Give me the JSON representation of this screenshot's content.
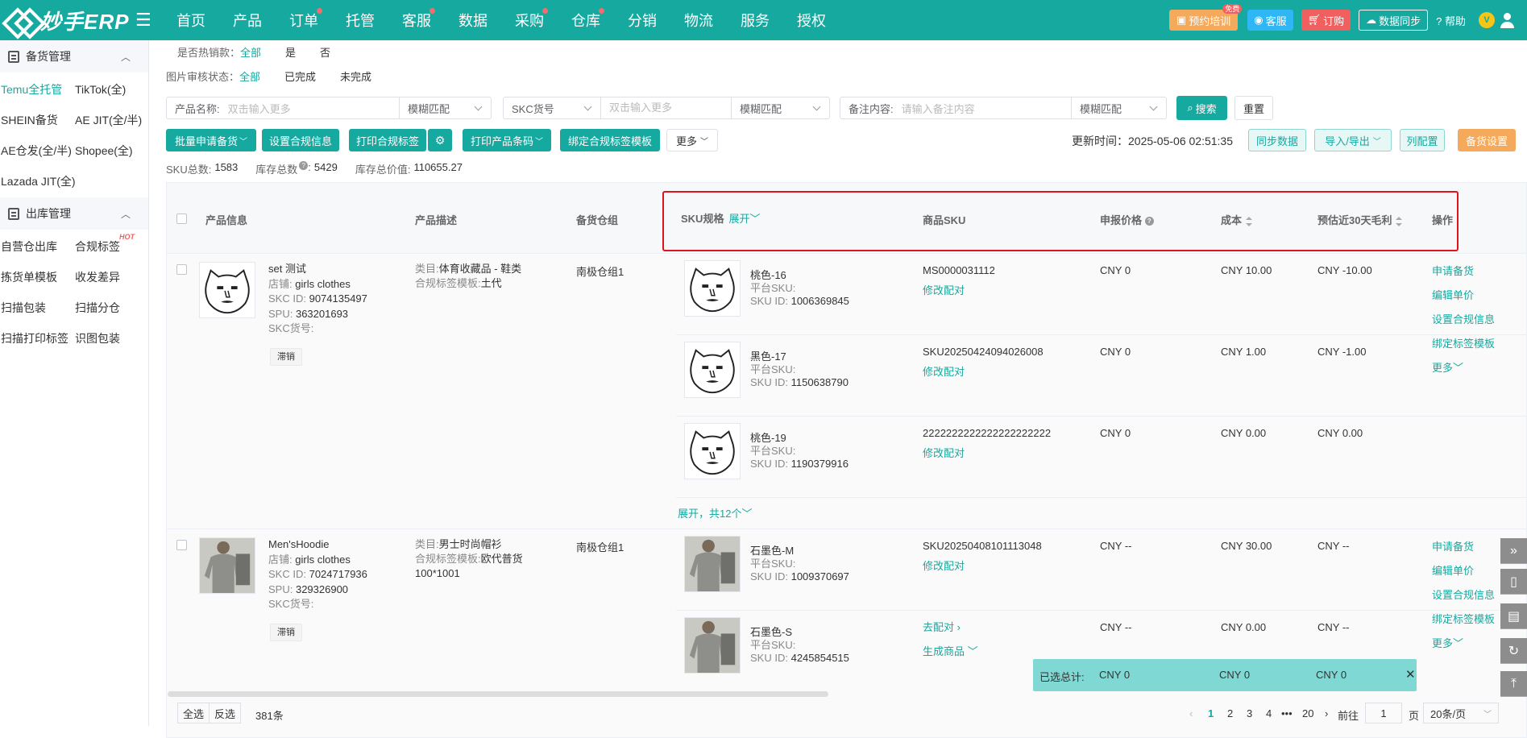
{
  "app": {
    "logo_text": "妙手ERP"
  },
  "nav": [
    "首页",
    "产品",
    "订单",
    "托管",
    "客服",
    "数据",
    "采购",
    "仓库",
    "分销",
    "物流",
    "服务",
    "授权"
  ],
  "nav_dots": [
    false,
    false,
    true,
    false,
    true,
    false,
    true,
    true,
    false,
    false,
    false,
    false
  ],
  "top_actions": {
    "training": "预约培训",
    "free": "免费",
    "service": "客服",
    "order": "订购",
    "sync": "数据同步",
    "help": "帮助",
    "avatar": "V"
  },
  "sidebar": {
    "section1": "备货管理",
    "section1_items": [
      "Temu全托管",
      "TikTok(全)",
      "SHEIN备货",
      "AE JIT(全/半)",
      "AE仓发(全/半)",
      "Shopee(全)",
      "Lazada JIT(全)"
    ],
    "section2": "出库管理",
    "section2_items": [
      "自营仓出库",
      "合规标签",
      "拣货单模板",
      "收发差异",
      "扫描包装",
      "扫描分仓",
      "扫描打印标签",
      "识图包装"
    ],
    "hot": "HOT"
  },
  "filters": {
    "hot_label": "是否热销款：",
    "hot_opts": [
      "全部",
      "是",
      "否"
    ],
    "img_label": "图片审核状态：",
    "img_opts": [
      "全部",
      "已完成",
      "未完成"
    ],
    "name_label": "产品名称:",
    "name_ph": "双击输入更多",
    "match1": "模糊匹配",
    "skc_label": "SKC货号",
    "skc_ph": "双击输入更多",
    "match2": "模糊匹配",
    "remark_label": "备注内容:",
    "remark_ph": "请输入备注内容",
    "match3": "模糊匹配",
    "search": "搜索",
    "reset": "重置"
  },
  "actions": {
    "batch": "批量申请备货",
    "compliance": "设置合规信息",
    "print_label": "打印合规标签",
    "print_barcode": "打印产品条码",
    "bind": "绑定合规标签模板",
    "more": "更多",
    "update_label": "更新时间：",
    "update_time": "2025-05-06 02:51:35",
    "sync": "同步数据",
    "import": "导入/导出",
    "cols": "列配置",
    "stock_set": "备货设置"
  },
  "stats": {
    "sku_label": "SKU总数:",
    "sku": "1583",
    "stock_label": "库存总数",
    "stock": "5429",
    "value_label": "库存总价值:",
    "value": "110655.27"
  },
  "headers": {
    "product": "产品信息",
    "desc": "产品描述",
    "warehouse": "备货仓组",
    "sku": "SKU规格",
    "expand": "展开",
    "goods_sku": "商品SKU",
    "price": "申报价格",
    "cost": "成本",
    "profit": "预估近30天毛利",
    "ops": "操作"
  },
  "labels": {
    "store": "店铺:",
    "skc_id": "SKC ID:",
    "spu": "SPU:",
    "skc_no": "SKC货号:",
    "category": "类目:",
    "tpl": "合规标签模板:",
    "platform_sku": "平台SKU:",
    "sku_id": "SKU ID:",
    "modify": "修改配对",
    "go_pair": "去配对",
    "gen": "生成商品"
  },
  "products": [
    {
      "name": "set 测试",
      "store": "girls clothes",
      "skc_id": "9074135497",
      "spu": "363201693",
      "tag": "滞销",
      "category": "体育收藏品 - 鞋类",
      "tpl": "土代",
      "warehouse": "南极仓组1",
      "skus": [
        {
          "spec": "桃色-16",
          "sku_id": "1006369845",
          "goods": "MS0000031112",
          "price": "CNY 0",
          "cost": "CNY 10.00",
          "profit": "CNY -10.00"
        },
        {
          "spec": "黑色-17",
          "sku_id": "1150638790",
          "goods": "SKU20250424094026008",
          "price": "CNY 0",
          "cost": "CNY 1.00",
          "profit": "CNY -1.00"
        },
        {
          "spec": "桃色-19",
          "sku_id": "1190379916",
          "goods": "2222222222222222222222",
          "price": "CNY 0",
          "cost": "CNY 0.00",
          "profit": "CNY 0.00"
        }
      ],
      "expand_more": "展开，共12个"
    },
    {
      "name": "Men'sHoodie",
      "store": "girls clothes",
      "skc_id": "7024717936",
      "spu": "329326900",
      "tag": "滞销",
      "category": "男士时尚帽衫",
      "tpl": "欧代普货 100*1001",
      "warehouse": "南极仓组1",
      "skus": [
        {
          "spec": "石墨色-M",
          "sku_id": "1009370697",
          "goods": "SKU20250408101113048",
          "price": "CNY --",
          "cost": "CNY 30.00",
          "profit": "CNY --"
        },
        {
          "spec": "石墨色-S",
          "sku_id": "4245854515",
          "goods": "",
          "price": "CNY --",
          "cost": "CNY 0.00",
          "profit": "CNY --"
        }
      ]
    }
  ],
  "row_ops": [
    "申请备货",
    "编辑单价",
    "设置合规信息",
    "绑定标签模板",
    "更多"
  ],
  "summary": {
    "label": "已选总计:",
    "price": "CNY 0",
    "cost": "CNY 0",
    "profit": "CNY 0"
  },
  "footer": {
    "select_all": "全选",
    "invert": "反选",
    "count": "381条",
    "pages": [
      "1",
      "2",
      "3",
      "4",
      "20"
    ],
    "goto": "前往",
    "page_val": "1",
    "page_unit": "页",
    "per_page": "20条/页"
  },
  "colors": {
    "primary": "#16a9a0",
    "highlight_box": "#e0141e"
  }
}
